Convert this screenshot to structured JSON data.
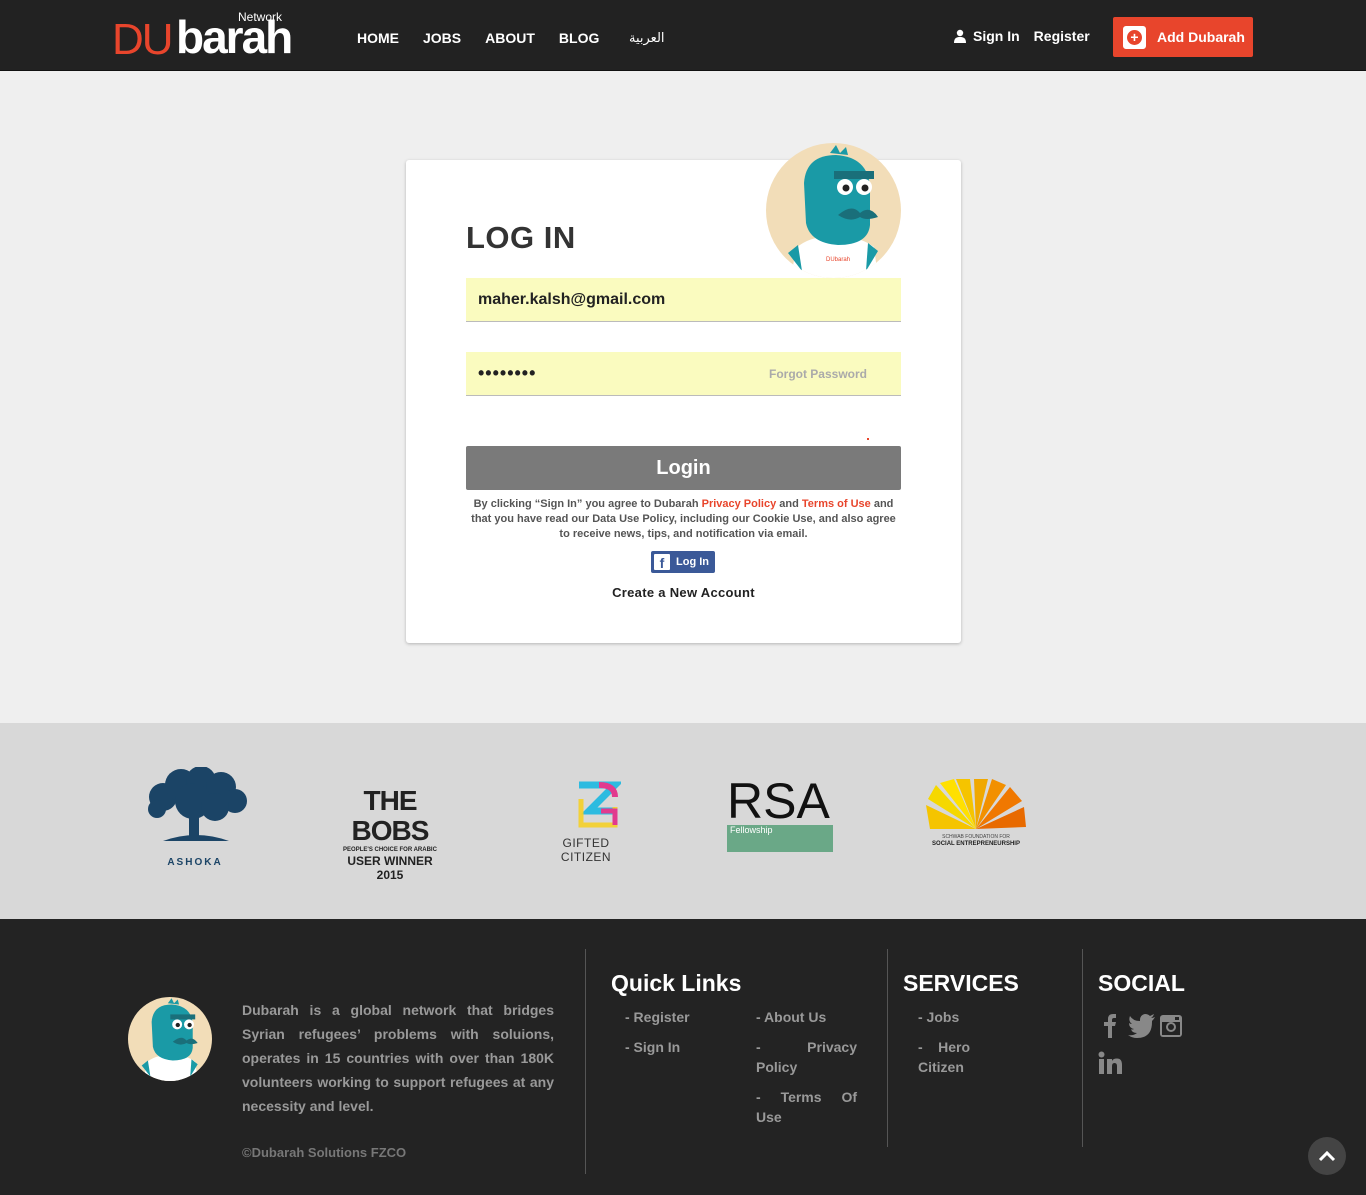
{
  "header": {
    "logo": {
      "du": "DU",
      "barah": "barah",
      "network": "Network"
    },
    "nav": [
      "HOME",
      "JOBS",
      "ABOUT",
      "BLOG"
    ],
    "arabic": "العربية",
    "sign_in": "Sign In",
    "register": "Register",
    "add_button": "Add Dubarah"
  },
  "login": {
    "title": "LOG IN",
    "email_value": "maher.kalsh@gmail.com",
    "password_value": "••••••••",
    "forgot": "Forgot Password",
    "button": "Login",
    "terms_pre": "By clicking “Sign In” you agree to Dubarah ",
    "privacy": "Privacy Policy",
    "and": " and ",
    "terms_of_use": "Terms of Use",
    "terms_post": " and that you have read our Data Use Policy, including our Cookie Use, and also agree to receive news, tips, and notification via email.",
    "fb_label": "Log In",
    "create": "Create a New Account"
  },
  "partners": {
    "ashoka": "ASHOKA",
    "bobs_title": "THE BOBS",
    "bobs_sub1": "PEOPLE'S CHOICE FOR ARABIC",
    "bobs_sub2": "USER WINNER 2015",
    "gifted": "GIFTED CITIZEN",
    "rsa": "RSA",
    "rsa_sub": "Fellowship",
    "schwab1": "SCHWAB FOUNDATION FOR",
    "schwab2": "SOCIAL ENTREPRENEURSHIP"
  },
  "footer": {
    "about": "Dubarah is a global network that bridges Syrian refugees’ problems with soluions, operates in 15 countries with over than 180K volunteers working to support refugees at any necessity and level.",
    "copyright": "©Dubarah Solutions FZCO",
    "quick_links_title": "Quick Links",
    "register": "- Register",
    "sign_in": "- Sign In",
    "about_us": "- About Us",
    "privacy_a": "-",
    "privacy_b": "Privacy",
    "privacy_c": "Policy",
    "terms_a": "-",
    "terms_b": "Terms",
    "terms_c": "Of",
    "terms_d": "Use",
    "services_title": "SERVICES",
    "jobs": "- Jobs",
    "hero_a": "-",
    "hero_b": "Hero",
    "hero_c": "Citizen",
    "social_title": "SOCIAL"
  },
  "colors": {
    "brand": "#e8452c",
    "dark": "#222222",
    "facebook": "#3b5998",
    "field": "#fafbbf"
  }
}
